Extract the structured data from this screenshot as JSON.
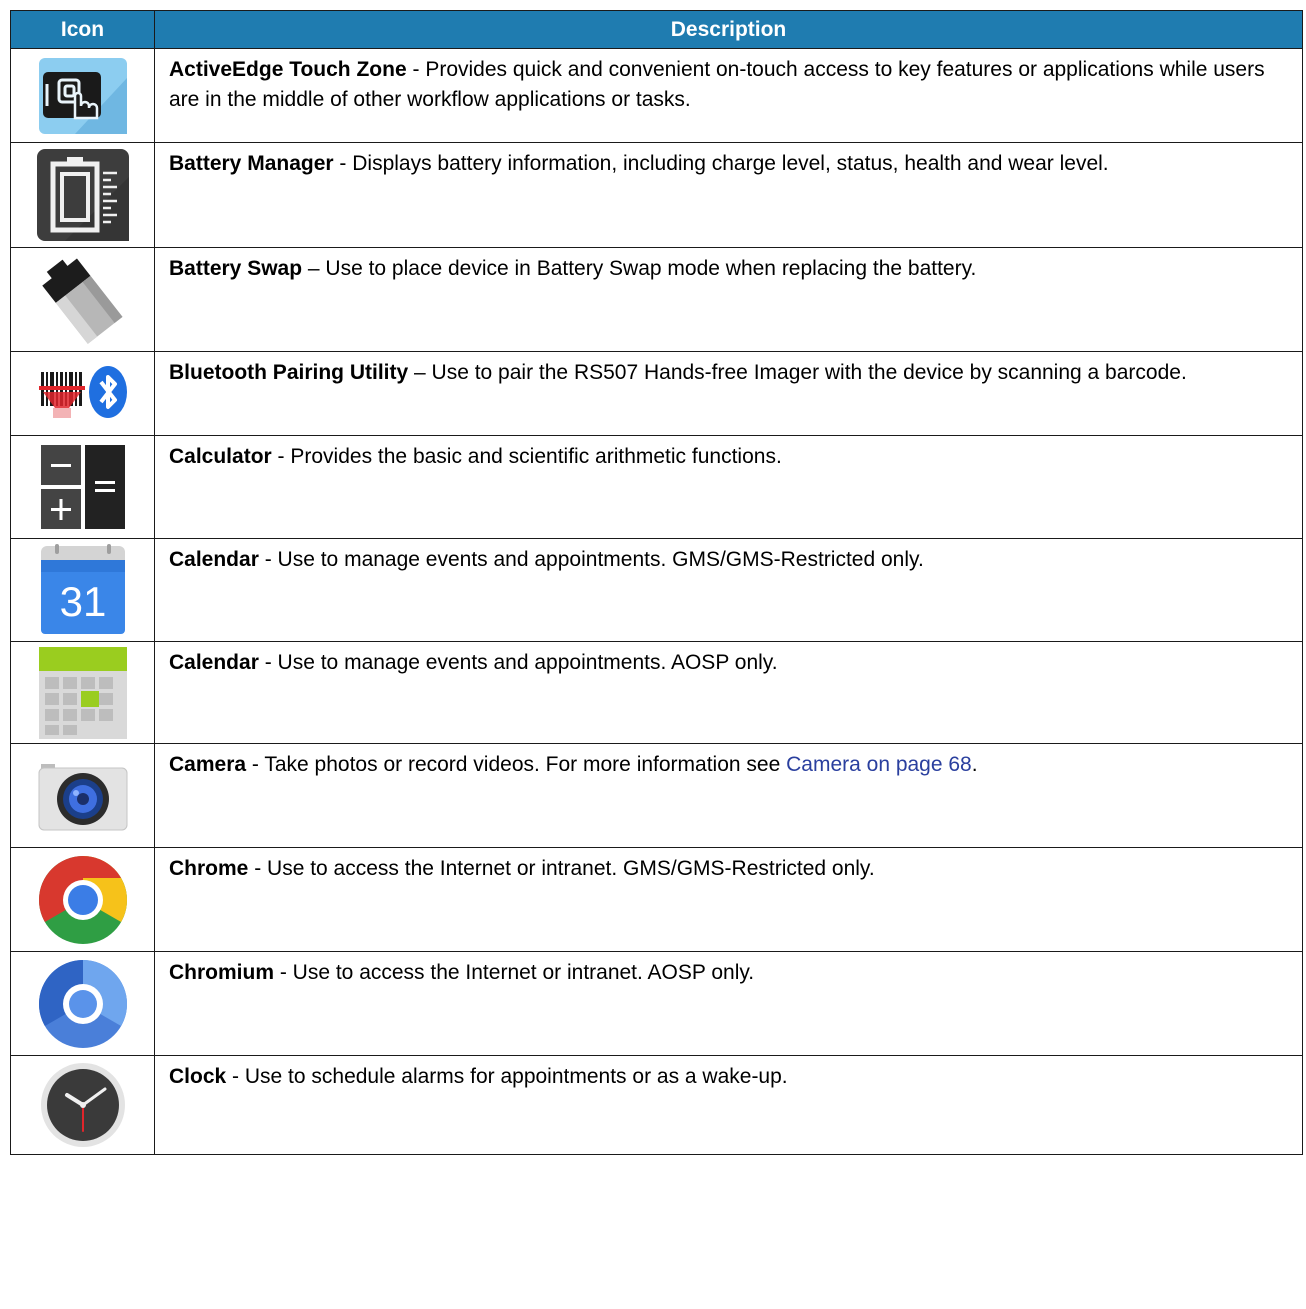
{
  "table": {
    "headers": {
      "icon": "Icon",
      "description": "Description"
    },
    "rows": [
      {
        "icon": "activeedge-touch-zone-icon",
        "name": "ActiveEdge Touch Zone",
        "sep": " - ",
        "text": "Provides quick and convenient on-touch access to key features or applications while users are in the middle of other workflow applications or tasks."
      },
      {
        "icon": "battery-manager-icon",
        "name": "Battery Manager",
        "sep": " - ",
        "text": "Displays battery information, including charge level, status, health and wear level."
      },
      {
        "icon": "battery-swap-icon",
        "name": "Battery Swap",
        "sep": " – ",
        "text": "Use to place device in Battery Swap mode when replacing the battery."
      },
      {
        "icon": "bluetooth-pairing-icon",
        "name": "Bluetooth Pairing Utility",
        "sep": " – ",
        "text": "Use to pair the RS507 Hands-free Imager with the device by scanning a barcode."
      },
      {
        "icon": "calculator-icon",
        "name": "Calculator",
        "sep": " - ",
        "text": "Provides the basic and scientific arithmetic functions."
      },
      {
        "icon": "google-calendar-icon",
        "name": "Calendar",
        "sep": " - ",
        "text": "Use to manage events and appointments. GMS/GMS-Restricted only.",
        "icon_text": "31"
      },
      {
        "icon": "aosp-calendar-icon",
        "name": "Calendar",
        "sep": " - ",
        "text": "Use to manage events and appointments. AOSP only."
      },
      {
        "icon": "camera-icon",
        "name": "Camera",
        "sep": " - ",
        "text": "Take photos or record videos. For more information see ",
        "link": "Camera on page 68",
        "after": "."
      },
      {
        "icon": "chrome-icon",
        "name": "Chrome",
        "sep": " - ",
        "text": "Use to access the Internet or intranet. GMS/GMS-Restricted only."
      },
      {
        "icon": "chromium-icon",
        "name": "Chromium",
        "sep": " - ",
        "text": "Use to access the Internet or intranet. AOSP only."
      },
      {
        "icon": "clock-icon",
        "name": "Clock",
        "sep": " - ",
        "text": "Use to schedule alarms for appointments or as a wake-up."
      }
    ]
  },
  "colors": {
    "header_bg": "#1f7cb0",
    "header_text": "#ffffff",
    "link": "#2a3f9e"
  }
}
